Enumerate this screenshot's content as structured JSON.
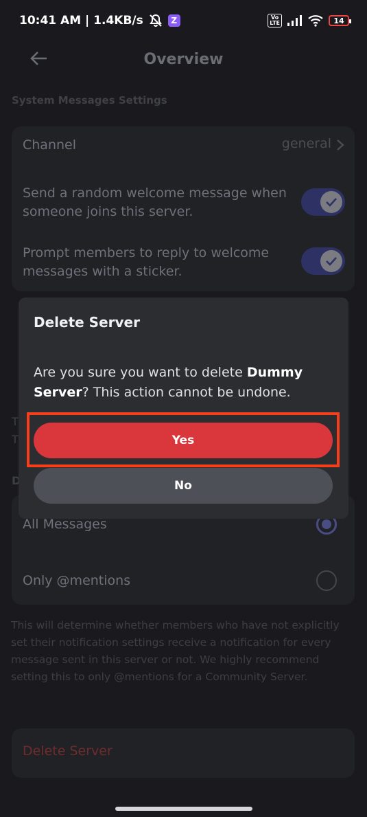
{
  "status_bar": {
    "time_speed": "10:41 AM | 1.4KB/s",
    "app_badge": "Z",
    "volte_line1": "Vo",
    "volte_line2": "LTE",
    "battery": "14"
  },
  "header": {
    "title": "Overview"
  },
  "system_messages": {
    "section_label": "System Messages Settings",
    "channel_label": "Channel",
    "channel_value": "general",
    "welcome_toggle_label": "Send a random welcome message when someone joins this server.",
    "sticker_toggle_label": "Prompt members to reply to welcome messages with a sticker."
  },
  "partially_hidden": {
    "line1_char": "T",
    "line2_char": "T",
    "section_char": "D"
  },
  "notifications": {
    "option_all": "All Messages",
    "option_mentions": "Only @mentions",
    "note": "This will determine whether members who have not explicitly set their notification settings receive a notification for every message sent in this server or not. We highly recommend setting this to only @mentions for a Community Server."
  },
  "danger": {
    "delete_label": "Delete Server"
  },
  "dialog": {
    "title": "Delete Server",
    "body_prefix": "Are you sure you want to delete ",
    "server_name": "Dummy Server",
    "body_suffix": "? This action cannot be undone.",
    "yes_label": "Yes",
    "no_label": "No"
  },
  "colors": {
    "danger_red": "#da373c",
    "highlight_orange": "#f43f1a",
    "toggle_blurple": "#2e3164"
  }
}
